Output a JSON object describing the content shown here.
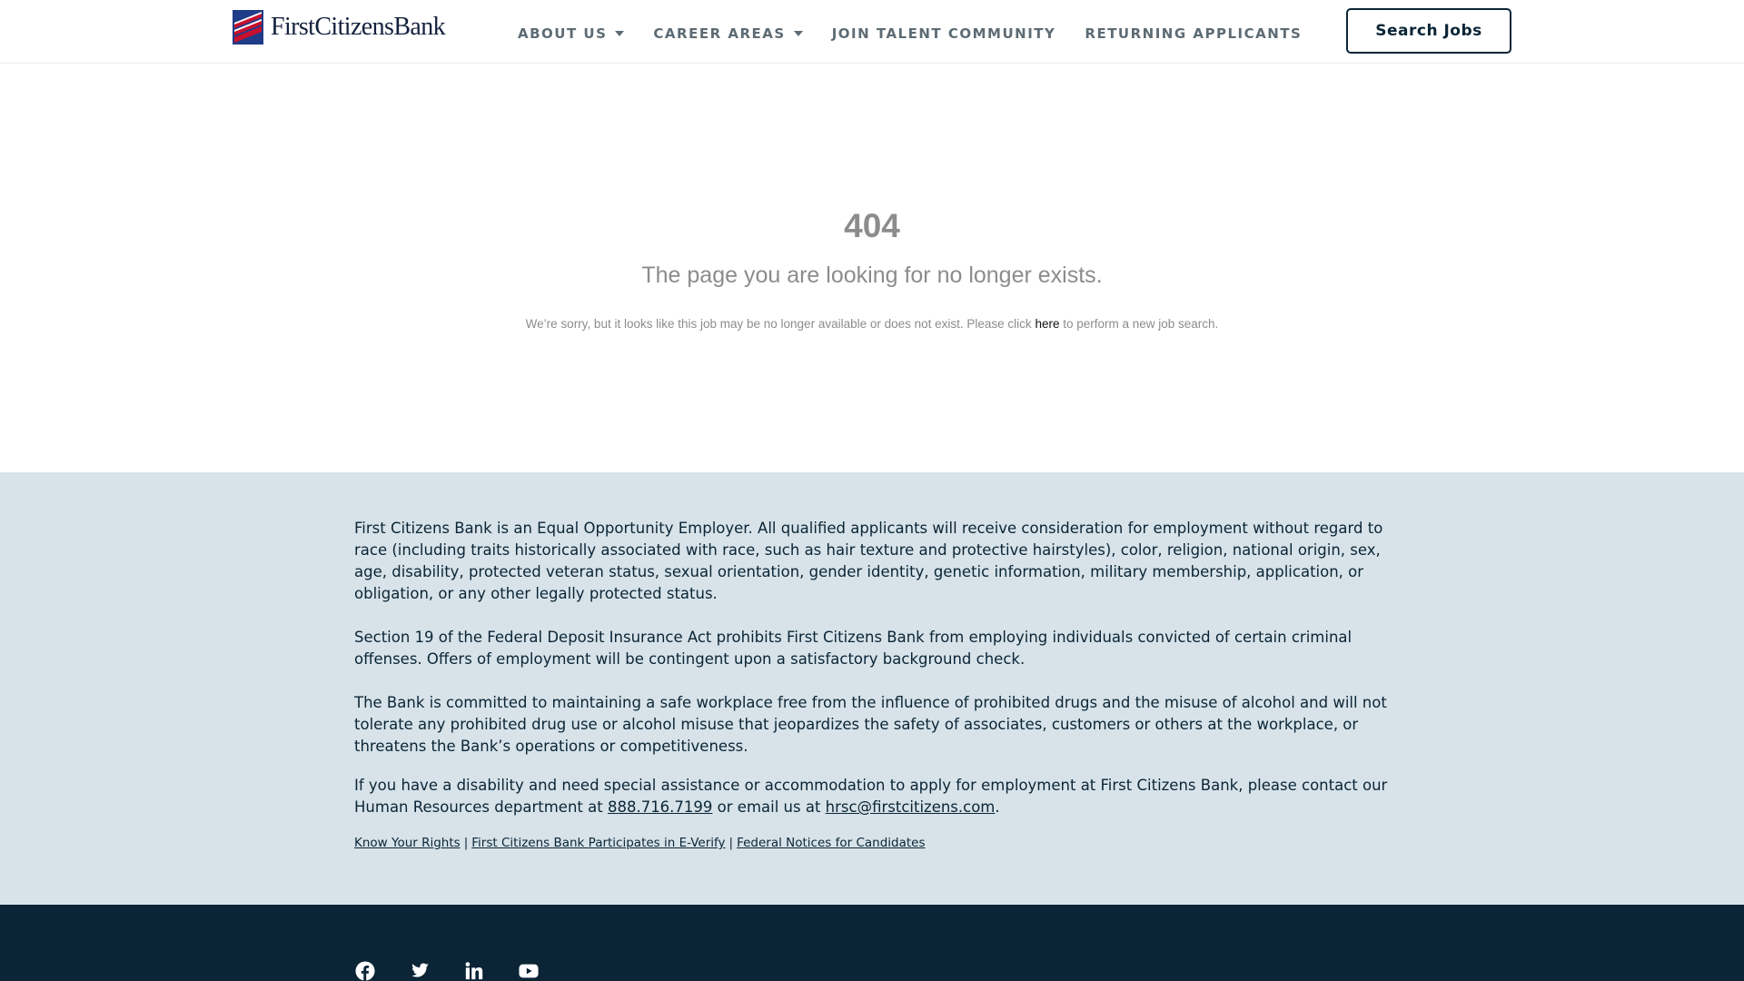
{
  "header": {
    "logo_text": "FirstCitizensBank",
    "nav": [
      {
        "label": "ABOUT US",
        "has_dropdown": true
      },
      {
        "label": "CAREER AREAS",
        "has_dropdown": true
      },
      {
        "label": "JOIN TALENT COMMUNITY",
        "has_dropdown": false
      },
      {
        "label": "RETURNING APPLICANTS",
        "has_dropdown": false
      }
    ],
    "search_button": "Search Jobs"
  },
  "error": {
    "code": "404",
    "title": "The page you are looking for no longer exists.",
    "message_before": "We’re sorry, but it looks like this job may be no longer available or does not exist. Please click ",
    "link_text": "here",
    "message_after": " to perform a new job search."
  },
  "legal": {
    "p1": "First Citizens Bank is an Equal Opportunity Employer. All qualified applicants will receive consideration for employment without regard to race (including traits historically associated with race, such as hair texture and protective hairstyles), color, religion, national origin, sex, age, disability, protected veteran status, sexual orientation, gender identity, genetic information, military membership, application, or obligation, or any other legally protected status.",
    "p2": "Section 19 of the Federal Deposit Insurance Act prohibits First Citizens Bank from employing individuals convicted of certain criminal offenses. Offers of employment will be contingent upon a satisfactory background check.",
    "p3": "The Bank is committed to maintaining a safe workplace free from the influence of prohibited drugs and the misuse of alcohol and will not tolerate any prohibited drug use or alcohol misuse that jeopardizes the safety of associates, customers or others at the workplace, or threatens the Bank’s operations or competitiveness.",
    "p4_before": "If you have a disability and need special assistance or accommodation to apply for employment at First Citizens Bank, please contact our Human Resources department at ",
    "phone": "888.716.7199",
    "p4_mid": " or email us at ",
    "email": "hrsc@firstcitizens.com",
    "p4_after": ".",
    "links": [
      "Know Your Rights",
      "First Citizens Bank Participates in E-Verify",
      "Federal Notices for Candidates"
    ],
    "separator": "|"
  },
  "footer": {
    "socials": [
      "facebook-icon",
      "twitter-icon",
      "linkedin-icon",
      "youtube-icon"
    ]
  },
  "colors": {
    "navy": "#0b2536",
    "legal_bg": "#d7e3e9",
    "muted_text": "#8c8c8c",
    "nav_text": "#5d6b74",
    "logo_red": "#c8102e",
    "logo_blue": "#1f3c88"
  }
}
